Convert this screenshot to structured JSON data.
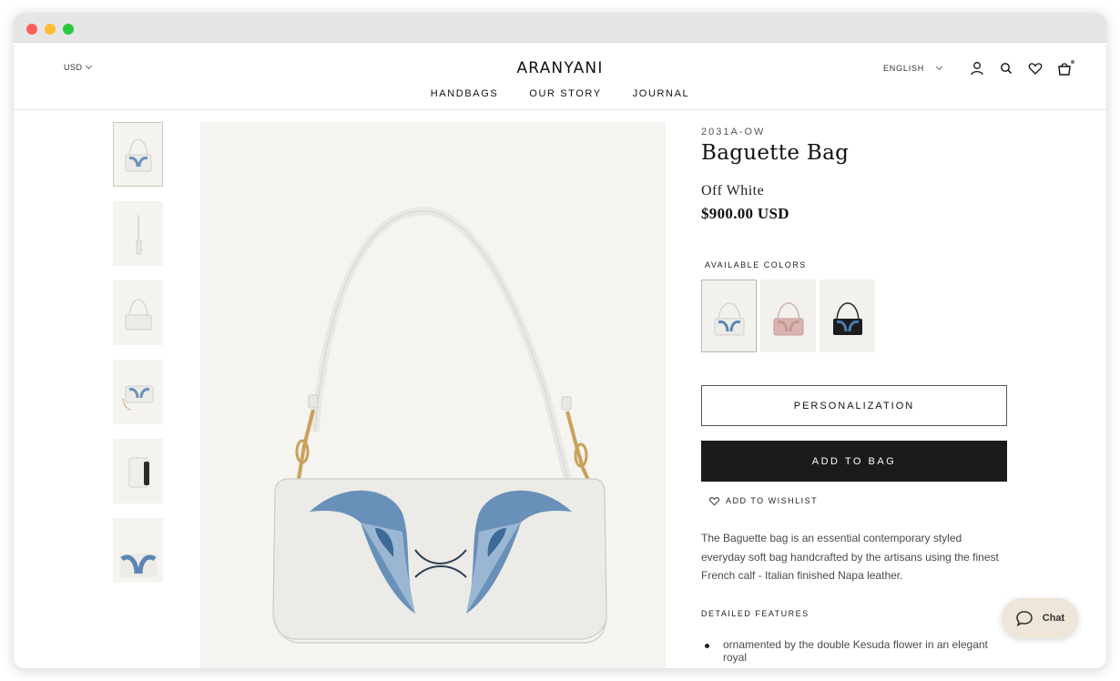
{
  "header": {
    "currency": "USD",
    "logo": "ARANYANI",
    "nav": [
      "HANDBAGS",
      "OUR STORY",
      "JOURNAL"
    ],
    "language": "ENGLISH",
    "icons": [
      "account-icon",
      "search-icon",
      "heart-icon",
      "bag-icon"
    ]
  },
  "product": {
    "sku": "2031A-OW",
    "title": "Baguette Bag",
    "color": "Off White",
    "price": "$900.00 USD",
    "available_colors_label": "AVAILABLE COLORS",
    "swatches": [
      {
        "name": "off-white",
        "color": "#ecebe8",
        "active": true
      },
      {
        "name": "pink",
        "color": "#d6b3b0",
        "active": false
      },
      {
        "name": "black",
        "color": "#1d1d1f",
        "active": false
      }
    ],
    "personalization_label": "PERSONALIZATION",
    "add_to_bag_label": "ADD TO BAG",
    "wishlist_label": "ADD TO WISHLIST",
    "description": "The Baguette bag is an essential contemporary styled everyday soft bag handcrafted by the artisans using the finest French calf - Italian finished Napa leather.",
    "features_label": "DETAILED FEATURES",
    "features": [
      "ornamented by the double Kesuda flower in an elegant royal"
    ]
  },
  "thumbnails": [
    "front-embroidered",
    "side-view",
    "front-plain",
    "chain-strap",
    "open-interior",
    "detail-embroidery"
  ],
  "chat": {
    "label": "Chat"
  },
  "colors": {
    "accent_dark": "#1c1a1b",
    "chat_bg": "#efe6da",
    "embroidery_blue": "#5a86b3"
  }
}
